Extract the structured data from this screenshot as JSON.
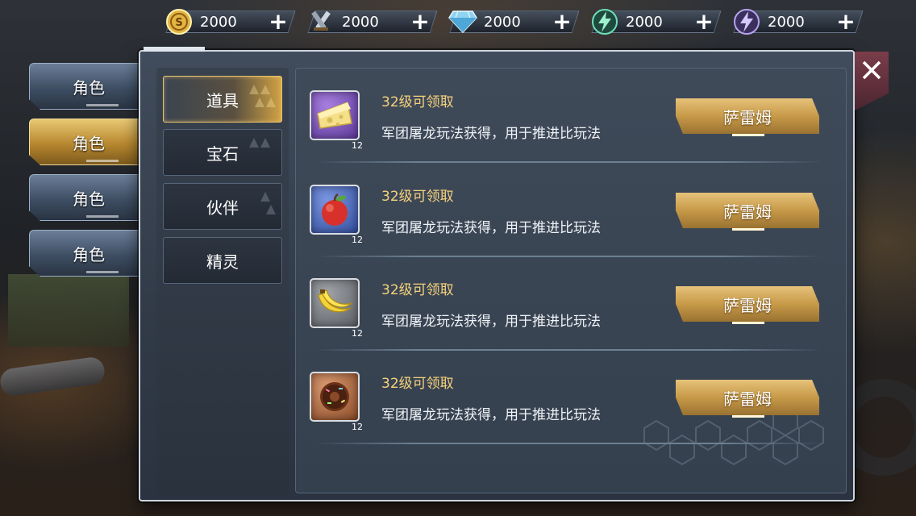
{
  "currencies": [
    {
      "icon": "gold-coin-icon",
      "value": "2000",
      "plus": "+"
    },
    {
      "icon": "crossed-swords-icon",
      "value": "2000",
      "plus": "+"
    },
    {
      "icon": "diamond-icon",
      "value": "2000",
      "plus": "+"
    },
    {
      "icon": "green-energy-icon",
      "value": "2000",
      "plus": "+"
    },
    {
      "icon": "purple-energy-icon",
      "value": "2000",
      "plus": "+"
    }
  ],
  "side_tabs": [
    {
      "label": "角色",
      "active": false
    },
    {
      "label": "角色",
      "active": true
    },
    {
      "label": "角色",
      "active": false
    },
    {
      "label": "角色",
      "active": false
    }
  ],
  "categories": [
    {
      "label": "道具",
      "active": true
    },
    {
      "label": "宝石",
      "active": false
    },
    {
      "label": "伙伴",
      "active": false
    },
    {
      "label": "精灵",
      "active": false
    }
  ],
  "items": [
    {
      "icon": "cheese-icon",
      "count": "12",
      "level": "32级可领取",
      "desc": "军团屠龙玩法获得，用于推进比玩法",
      "button": "萨雷姆",
      "frame_color": "#7b4fb8"
    },
    {
      "icon": "apple-icon",
      "count": "12",
      "level": "32级可领取",
      "desc": "军团屠龙玩法获得，用于推进比玩法",
      "button": "萨雷姆",
      "frame_color": "#4a66b8"
    },
    {
      "icon": "banana-icon",
      "count": "12",
      "level": "32级可领取",
      "desc": "军团屠龙玩法获得，用于推进比玩法",
      "button": "萨雷姆",
      "frame_color": "#7d8084"
    },
    {
      "icon": "donut-icon",
      "count": "12",
      "level": "32级可领取",
      "desc": "军团屠龙玩法获得，用于推进比玩法",
      "button": "萨雷姆",
      "frame_color": "#b5714a"
    }
  ],
  "close": {
    "icon": "close-icon"
  }
}
